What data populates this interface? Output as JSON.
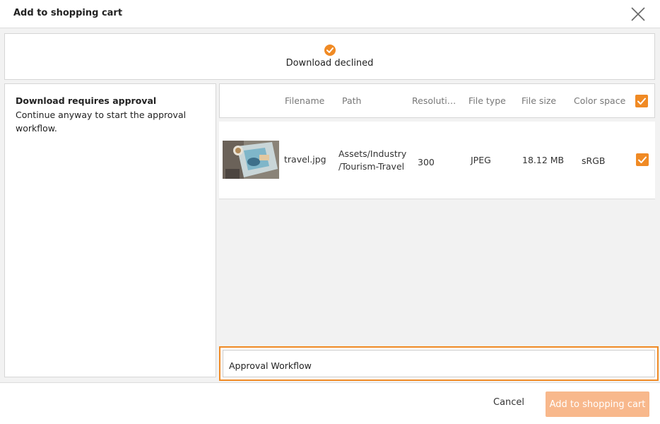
{
  "dialog": {
    "title": "Add to shopping cart"
  },
  "status": {
    "text": "Download declined",
    "icon": "check-circle-icon",
    "color": "#f08a24"
  },
  "approval": {
    "heading": "Download requires approval",
    "description": "Continue anyway to start the approval workflow."
  },
  "table": {
    "columns": [
      "Filename",
      "Path",
      "Resoluti…",
      "File type",
      "File size",
      "Color space"
    ],
    "rows": [
      {
        "filename": "travel.jpg",
        "path_line1": "Assets/Industry",
        "path_line2": "/Tourism-Travel",
        "resolution": "300",
        "file_type": "JPEG",
        "file_size": "18.12 MB",
        "color_space": "sRGB",
        "selected": true
      }
    ]
  },
  "workflow": {
    "value": "Approval Workflow"
  },
  "footer": {
    "cancel_label": "Cancel",
    "add_label": "Add to shopping cart"
  },
  "colors": {
    "accent": "#f08a24",
    "accent_disabled": "#f8b88c"
  }
}
